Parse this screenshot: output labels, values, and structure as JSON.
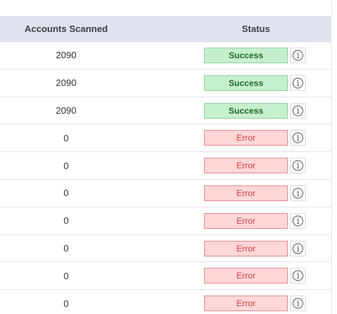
{
  "columns": {
    "accounts": "Accounts Scanned",
    "status": "Status"
  },
  "colors": {
    "success_bg": "#c6efce",
    "success_text": "#1d6b2c",
    "error_bg": "#ffd7d7",
    "error_text": "#d43b3b",
    "header_bg": "#dfe3ee"
  },
  "rows": [
    {
      "accounts": "2090",
      "status": "Success",
      "status_type": "success",
      "icon": "info-icon"
    },
    {
      "accounts": "2090",
      "status": "Success",
      "status_type": "success",
      "icon": "info-icon"
    },
    {
      "accounts": "2090",
      "status": "Success",
      "status_type": "success",
      "icon": "info-icon"
    },
    {
      "accounts": "0",
      "status": "Error",
      "status_type": "error",
      "icon": "info-icon"
    },
    {
      "accounts": "0",
      "status": "Error",
      "status_type": "error",
      "icon": "info-icon"
    },
    {
      "accounts": "0",
      "status": "Error",
      "status_type": "error",
      "icon": "info-icon"
    },
    {
      "accounts": "0",
      "status": "Error",
      "status_type": "error",
      "icon": "info-icon"
    },
    {
      "accounts": "0",
      "status": "Error",
      "status_type": "error",
      "icon": "info-icon"
    },
    {
      "accounts": "0",
      "status": "Error",
      "status_type": "error",
      "icon": "info-icon"
    },
    {
      "accounts": "0",
      "status": "Error",
      "status_type": "error",
      "icon": "info-icon"
    }
  ]
}
